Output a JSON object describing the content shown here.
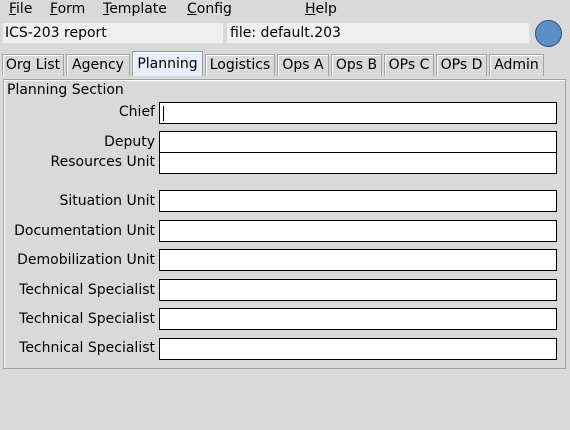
{
  "menubar": {
    "file": {
      "key": "F",
      "rest": "ile"
    },
    "form": {
      "key": "F",
      "rest": "orm"
    },
    "template": {
      "key": "T",
      "rest": "emplate"
    },
    "config": {
      "key": "C",
      "rest": "onfig"
    },
    "help": {
      "key": "H",
      "rest": "elp"
    }
  },
  "header": {
    "report_title": "ICS-203 report",
    "file_label": "file: default.203"
  },
  "tabs": {
    "org_list": "Org List",
    "agency": "Agency",
    "planning": "Planning",
    "logistics": "Logistics",
    "ops_a": "Ops A",
    "ops_b": "Ops B",
    "ops_c": "OPs C",
    "ops_d": "OPs D",
    "admin": "Admin",
    "active": "Planning"
  },
  "section": {
    "title": "Planning Section",
    "fields": [
      {
        "label": "Chief",
        "value": ""
      },
      {
        "label": "Deputy",
        "value": ""
      },
      {
        "label": "Resources Unit",
        "value": ""
      },
      {
        "label": "Situation Unit",
        "value": ""
      },
      {
        "label": "Documentation Unit",
        "value": ""
      },
      {
        "label": "Demobilization Unit",
        "value": ""
      },
      {
        "label": "Technical Specialist",
        "value": ""
      },
      {
        "label": "Technical Specialist",
        "value": ""
      },
      {
        "label": "Technical Specialist",
        "value": ""
      }
    ]
  },
  "colors": {
    "status_circle": "#5b8fc6",
    "active_tab": "#e6eef9"
  }
}
